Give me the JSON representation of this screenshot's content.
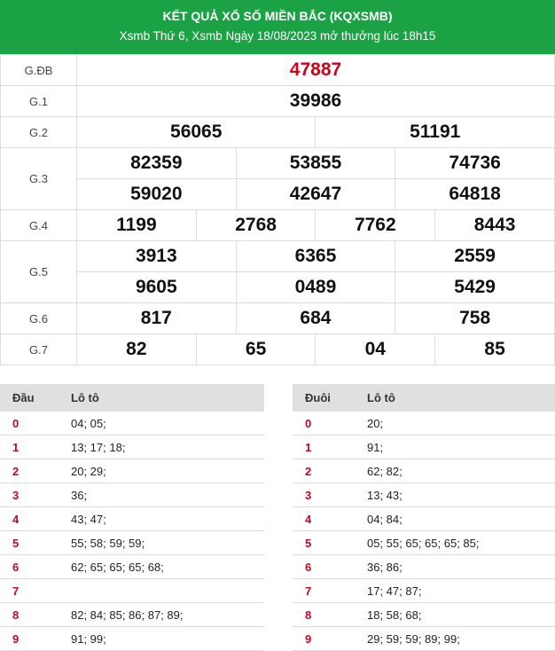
{
  "header": {
    "title": "KẾT QUẢ XỔ SỐ MIỀN BẮC (KQXSMB)",
    "subtitle": "Xsmb Thứ 6, Xsmb Ngày 18/08/2023 mở thưởng lúc 18h15"
  },
  "results": {
    "db": {
      "label": "G.ĐB",
      "values": [
        "47887"
      ]
    },
    "g1": {
      "label": "G.1",
      "values": [
        "39986"
      ]
    },
    "g2": {
      "label": "G.2",
      "values": [
        "56065",
        "51191"
      ]
    },
    "g3": {
      "label": "G.3",
      "values": [
        "82359",
        "53855",
        "74736",
        "59020",
        "42647",
        "64818"
      ]
    },
    "g4": {
      "label": "G.4",
      "values": [
        "1199",
        "2768",
        "7762",
        "8443"
      ]
    },
    "g5": {
      "label": "G.5",
      "values": [
        "3913",
        "6365",
        "2559",
        "9605",
        "0489",
        "5429"
      ]
    },
    "g6": {
      "label": "G.6",
      "values": [
        "817",
        "684",
        "758"
      ]
    },
    "g7": {
      "label": "G.7",
      "values": [
        "82",
        "65",
        "04",
        "85"
      ]
    }
  },
  "dau": {
    "col_key": "Đầu",
    "col_val": "Lô tô",
    "rows": [
      {
        "k": "0",
        "v": "04; 05;"
      },
      {
        "k": "1",
        "v": "13; 17; 18;"
      },
      {
        "k": "2",
        "v": "20; 29;"
      },
      {
        "k": "3",
        "v": "36;"
      },
      {
        "k": "4",
        "v": "43; 47;"
      },
      {
        "k": "5",
        "v": "55; 58; 59; 59;"
      },
      {
        "k": "6",
        "v": "62; 65; 65; 65; 68;"
      },
      {
        "k": "7",
        "v": ""
      },
      {
        "k": "8",
        "v": "82; 84; 85; 86; 87; 89;"
      },
      {
        "k": "9",
        "v": "91; 99;"
      }
    ]
  },
  "duoi": {
    "col_key": "Đuôi",
    "col_val": "Lô tô",
    "rows": [
      {
        "k": "0",
        "v": "20;"
      },
      {
        "k": "1",
        "v": "91;"
      },
      {
        "k": "2",
        "v": "62; 82;"
      },
      {
        "k": "3",
        "v": "13; 43;"
      },
      {
        "k": "4",
        "v": "04; 84;"
      },
      {
        "k": "5",
        "v": "05; 55; 65; 65; 65; 85;"
      },
      {
        "k": "6",
        "v": "36; 86;"
      },
      {
        "k": "7",
        "v": "17; 47; 87;"
      },
      {
        "k": "8",
        "v": "18; 58; 68;"
      },
      {
        "k": "9",
        "v": "29; 59; 59; 89; 99;"
      }
    ]
  },
  "colors": {
    "header_bg": "#1aa244",
    "special_prize": "#d0021b",
    "key_digit": "#d0021b"
  }
}
